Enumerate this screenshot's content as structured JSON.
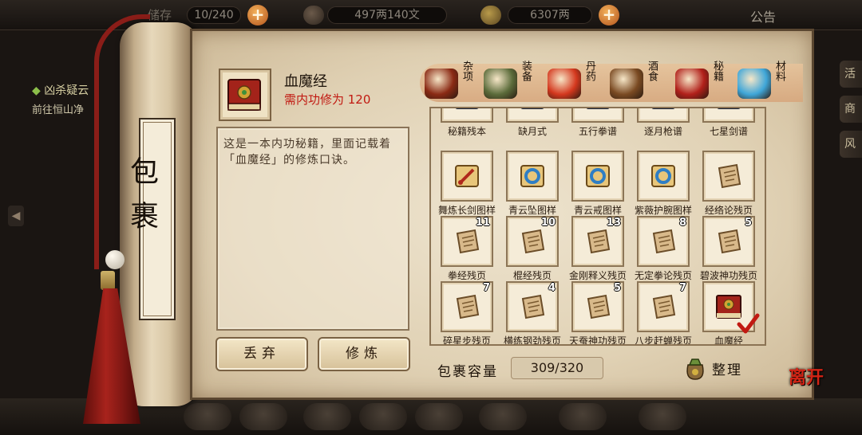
{
  "topbar": {
    "bag_count": "10/240",
    "copper": "497两140文",
    "gold": "6307两",
    "notice": "公告"
  },
  "quest": {
    "title": "凶杀疑云",
    "desc": "前往恒山净"
  },
  "right_tabs": [
    "活",
    "商",
    "风"
  ],
  "scroll_label": "包裹",
  "detail": {
    "name": "血魔经",
    "requirement": "需内功修为 120",
    "description": "这是一本内功秘籍，里面记载着「血魔经」的修炼口诀。",
    "discard_label": "丢弃",
    "practice_label": "修炼"
  },
  "categories": [
    {
      "label": "杂项",
      "icon": "jar-icon",
      "color": "#8a2a14"
    },
    {
      "label": "装备",
      "icon": "armor-icon",
      "color": "#5b6b3a"
    },
    {
      "label": "丹药",
      "icon": "pills-icon",
      "color": "#d4381e"
    },
    {
      "label": "酒食",
      "icon": "wine-food-icon",
      "color": "#7a4a22"
    },
    {
      "label": "秘籍",
      "icon": "book-icon",
      "color": "#b1201a"
    },
    {
      "label": "材料",
      "icon": "crystal-icon",
      "color": "#3fa6d8"
    }
  ],
  "active_category": "秘籍",
  "items": [
    {
      "name": "秘籍残本",
      "count": "",
      "kind": "blue-book"
    },
    {
      "name": "缺月式",
      "count": "",
      "kind": "blue-book"
    },
    {
      "name": "五行拳谱",
      "count": "",
      "kind": "blue-book"
    },
    {
      "name": "逐月枪谱",
      "count": "",
      "kind": "blue-book"
    },
    {
      "name": "七星剑谱",
      "count": "",
      "kind": "blue-book"
    },
    {
      "name": "舞炼长剑图样",
      "count": "",
      "kind": "red-scroll"
    },
    {
      "name": "青云坠图样",
      "count": "",
      "kind": "blue-scroll"
    },
    {
      "name": "青云戒图样",
      "count": "",
      "kind": "blue-scroll"
    },
    {
      "name": "紫薇护腕图样",
      "count": "",
      "kind": "blue-scroll"
    },
    {
      "name": "经络论残页",
      "count": "",
      "kind": "page"
    },
    {
      "name": "拳经残页",
      "count": "11",
      "kind": "page"
    },
    {
      "name": "棍经残页",
      "count": "10",
      "kind": "page"
    },
    {
      "name": "金刚释义残页",
      "count": "13",
      "kind": "page"
    },
    {
      "name": "无定拳论残页",
      "count": "8",
      "kind": "page"
    },
    {
      "name": "碧波神功残页",
      "count": "5",
      "kind": "page"
    },
    {
      "name": "碎星步残页",
      "count": "7",
      "kind": "page"
    },
    {
      "name": "横练钢劲残页",
      "count": "4",
      "kind": "page"
    },
    {
      "name": "天蚕神功残页",
      "count": "5",
      "kind": "page"
    },
    {
      "name": "八步赶蝉残页",
      "count": "7",
      "kind": "page"
    },
    {
      "name": "血魔经",
      "count": "",
      "kind": "red-book",
      "selected": true
    }
  ],
  "capacity": {
    "label": "包裹容量",
    "value": "309/320"
  },
  "sort_label": "整理",
  "leave_label": "离开"
}
